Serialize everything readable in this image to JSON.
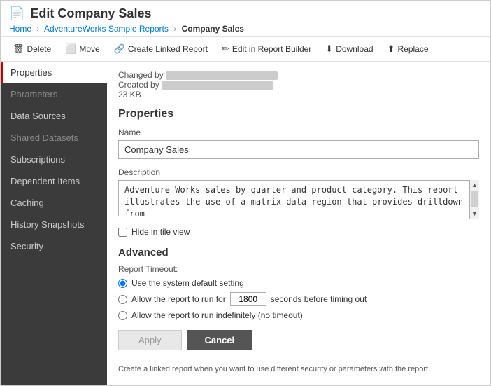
{
  "header": {
    "icon": "📄",
    "title": "Edit Company Sales",
    "breadcrumb": {
      "home": "Home",
      "section": "AdventureWorks Sample Reports",
      "current": "Company Sales"
    }
  },
  "toolbar": {
    "buttons": [
      {
        "id": "delete",
        "icon": "🗑",
        "label": "Delete"
      },
      {
        "id": "move",
        "icon": "⬜",
        "label": "Move"
      },
      {
        "id": "create-linked",
        "icon": "🔗",
        "label": "Create Linked Report"
      },
      {
        "id": "edit-builder",
        "icon": "✏",
        "label": "Edit in Report Builder"
      },
      {
        "id": "download",
        "icon": "⬇",
        "label": "Download"
      },
      {
        "id": "replace",
        "icon": "⬆",
        "label": "Replace"
      }
    ]
  },
  "sidebar": {
    "items": [
      {
        "id": "properties",
        "label": "Properties",
        "active": true
      },
      {
        "id": "parameters",
        "label": "Parameters",
        "disabled": true
      },
      {
        "id": "data-sources",
        "label": "Data Sources"
      },
      {
        "id": "shared-datasets",
        "label": "Shared Datasets",
        "disabled": true
      },
      {
        "id": "subscriptions",
        "label": "Subscriptions"
      },
      {
        "id": "dependent-items",
        "label": "Dependent Items"
      },
      {
        "id": "caching",
        "label": "Caching"
      },
      {
        "id": "history-snapshots",
        "label": "History Snapshots"
      },
      {
        "id": "security",
        "label": "Security"
      }
    ]
  },
  "content": {
    "meta": {
      "changed_by_label": "Changed by",
      "created_by_label": "Created by",
      "size": "23 KB"
    },
    "properties_section": "Properties",
    "name_label": "Name",
    "name_value": "Company Sales",
    "description_label": "Description",
    "description_value": "Adventure Works sales by quarter and product category. This report illustrates the use of a matrix data region that provides drilldown from",
    "hide_tile_label": "Hide in tile view",
    "advanced_section": "Advanced",
    "report_timeout_label": "Report Timeout:",
    "radio_system_default": "Use the system default setting",
    "radio_allow_run_for": "Allow the report to run for",
    "timeout_value": "1800",
    "radio_seconds_label": "seconds before timing out",
    "radio_indefinitely": "Allow the report to run indefinitely (no timeout)",
    "apply_label": "Apply",
    "cancel_label": "Cancel",
    "footer_note": "Create a linked report when you want to use different security or parameters with the report."
  }
}
